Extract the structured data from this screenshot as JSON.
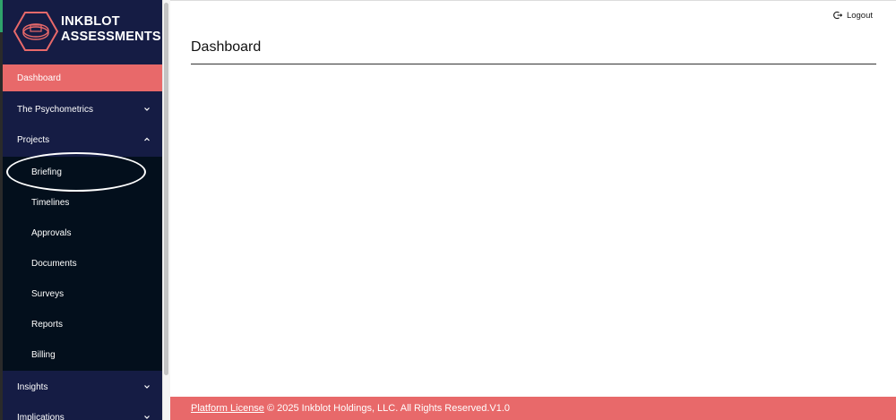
{
  "brand": {
    "line1": "INKBLOT",
    "line2": "ASSESSMENTS",
    "logo_icon": "inkblot-hexagon-logo"
  },
  "sidebar": {
    "items": [
      {
        "label": "Dashboard",
        "active": true
      },
      {
        "label": "The Psychometrics",
        "chevron": "down"
      },
      {
        "label": "Projects",
        "chevron": "up",
        "expanded": true
      },
      {
        "label": "Insights",
        "chevron": "down"
      },
      {
        "label": "Implications",
        "chevron": "down"
      }
    ],
    "projects_submenu": [
      "Briefing",
      "Timelines",
      "Approvals",
      "Documents",
      "Surveys",
      "Reports",
      "Billing"
    ]
  },
  "header": {
    "logout_label": "Logout",
    "logout_icon": "logout-icon"
  },
  "main": {
    "page_title": "Dashboard"
  },
  "footer": {
    "license_link": "Platform License",
    "copyright": " © 2025 Inkblot Holdings, LLC. All Rights Reserved.V1.0"
  },
  "colors": {
    "sidebar_bg": "#151c44",
    "submenu_bg": "#030f1c",
    "accent": "#e8696a",
    "text_dark": "#111111"
  }
}
